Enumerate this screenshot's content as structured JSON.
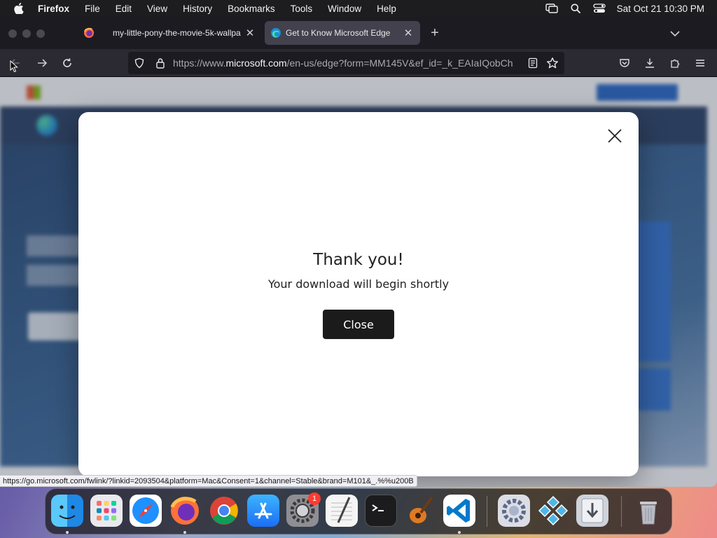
{
  "menubar": {
    "app_name": "Firefox",
    "items": [
      "File",
      "Edit",
      "View",
      "History",
      "Bookmarks",
      "Tools",
      "Window",
      "Help"
    ],
    "clock": "Sat Oct 21  10:30 PM"
  },
  "tabs": [
    {
      "title": "my-little-pony-the-movie-5k-wallpa",
      "active": false
    },
    {
      "title": "Get to Know Microsoft Edge",
      "active": true
    }
  ],
  "urlbar": {
    "prefix": "https://www.",
    "host": "microsoft.com",
    "path": "/en-us/edge?form=MM145V&ef_id=_k_EAIaIQobCh"
  },
  "modal": {
    "title": "Thank you!",
    "subtitle": "Your download will begin shortly",
    "close_label": "Close"
  },
  "status_link": "https://go.microsoft.com/fwlink/?linkid=2093504&platform=Mac&Consent=1&channel=Stable&brand=M101&_.%%u200B",
  "dock": {
    "system_preferences_badge": "1",
    "icons": [
      "finder-icon",
      "launchpad-icon",
      "safari-icon",
      "firefox-icon",
      "chrome-icon",
      "app-store-icon",
      "system-preferences-icon",
      "textedit-icon",
      "terminal-icon",
      "garageband-icon",
      "vscode-icon",
      "settings-utility-icon",
      "ppsspp-icon",
      "downloads-icon",
      "trash-icon"
    ]
  },
  "colors": {
    "menubar_bg": "#1d1d1f",
    "tab_active_bg": "#42414d",
    "close_button_bg": "#1b1b1b",
    "badge_red": "#ff3b30"
  }
}
